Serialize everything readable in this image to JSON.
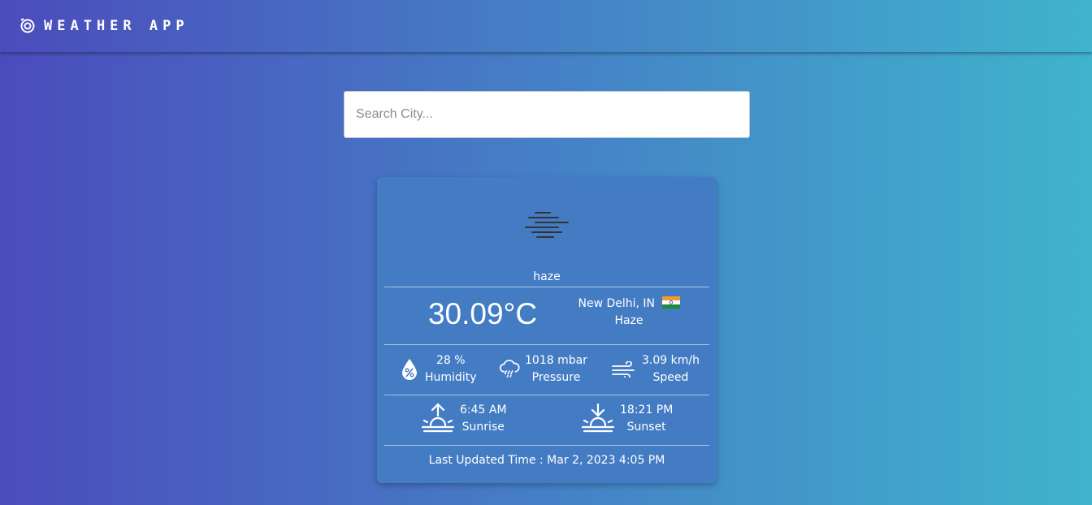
{
  "header": {
    "title": "WEATHER APP",
    "logo_icon": "target-icon"
  },
  "search": {
    "placeholder": "Search City...",
    "value": ""
  },
  "weather": {
    "condition_icon": "haze-icon",
    "condition": "haze",
    "temperature": "30.09°C",
    "location": "New Delhi, IN",
    "country_flag": "india-flag-icon",
    "description": "Haze",
    "humidity_value": "28 %",
    "humidity_label": "Humidity",
    "pressure_value": "1018 mbar",
    "pressure_label": "Pressure",
    "wind_value": "3.09 km/h",
    "wind_label": "Speed",
    "sunrise_value": "6:45 AM",
    "sunrise_label": "Sunrise",
    "sunset_value": "18:21 PM",
    "sunset_label": "Sunset",
    "last_updated": "Last Updated Time : Mar 2, 2023 4:05 PM"
  },
  "colors": {
    "gradient_start": "#4b4cbc",
    "gradient_end": "#40b3cd",
    "card": "#447cc4"
  }
}
